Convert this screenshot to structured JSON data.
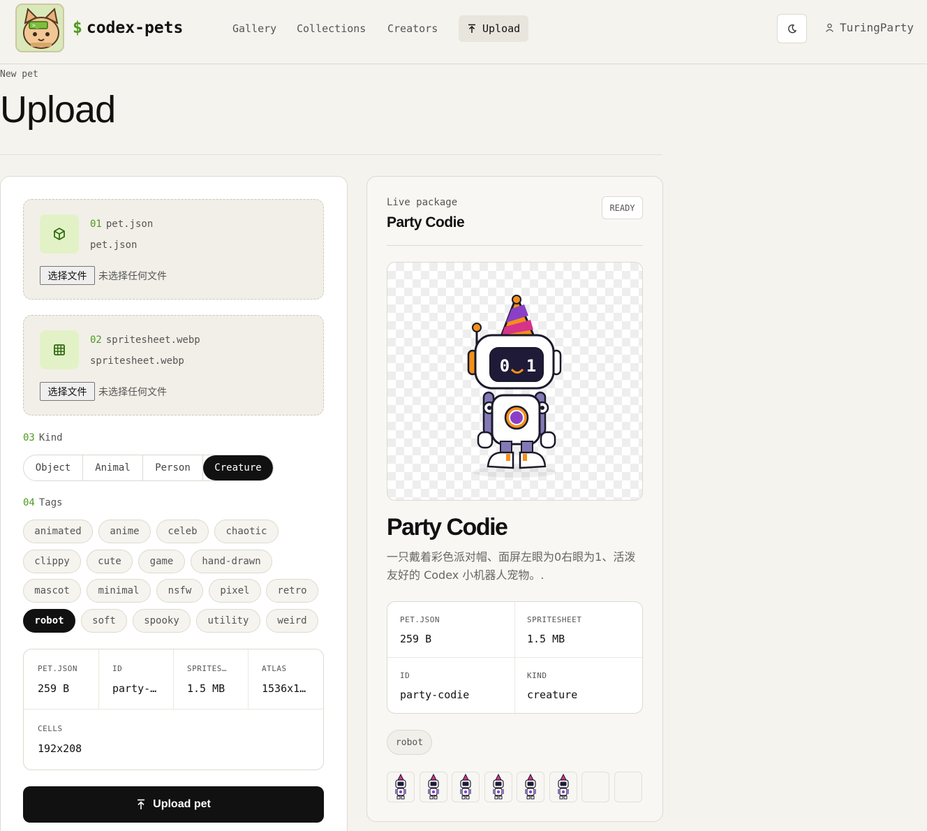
{
  "header": {
    "brand_symbol": "$",
    "brand": "codex-pets",
    "nav": [
      "Gallery",
      "Collections",
      "Creators",
      "Upload"
    ],
    "active_nav": "Upload",
    "user": "TuringParty"
  },
  "page": {
    "eyebrow": "New pet",
    "title": "Upload"
  },
  "form": {
    "files": [
      {
        "step": "01",
        "label": "pet.json",
        "filename": "pet.json",
        "button": "选择文件",
        "status": "未选择任何文件"
      },
      {
        "step": "02",
        "label": "spritesheet.webp",
        "filename": "spritesheet.webp",
        "button": "选择文件",
        "status": "未选择任何文件"
      }
    ],
    "kind": {
      "step": "03",
      "label": "Kind",
      "options": [
        "Object",
        "Animal",
        "Person",
        "Creature"
      ],
      "selected": "Creature"
    },
    "tags": {
      "step": "04",
      "label": "Tags",
      "options": [
        "animated",
        "anime",
        "celeb",
        "chaotic",
        "clippy",
        "cute",
        "game",
        "hand-drawn",
        "mascot",
        "minimal",
        "nsfw",
        "pixel",
        "retro",
        "robot",
        "soft",
        "spooky",
        "utility",
        "weird"
      ],
      "selected": [
        "robot"
      ]
    },
    "stats": [
      {
        "key": "PET.JSON",
        "value": "259 B"
      },
      {
        "key": "ID",
        "value": "party-…"
      },
      {
        "key": "SPRITES…",
        "value": "1.5 MB"
      },
      {
        "key": "ATLAS",
        "value": "1536x1…"
      },
      {
        "key": "CELLS",
        "value": "192x208"
      }
    ],
    "submit": "Upload pet"
  },
  "preview": {
    "label": "Live package",
    "name": "Party Codie",
    "status": "READY",
    "title": "Party Codie",
    "description": "一只戴着彩色派对帽、面屏左眼为0右眼为1、活泼友好的 Codex 小机器人宠物。.",
    "face_left": "0",
    "face_right": "1",
    "stats": [
      {
        "key": "PET.JSON",
        "value": "259 B"
      },
      {
        "key": "SPRITESHEET",
        "value": "1.5 MB"
      },
      {
        "key": "ID",
        "value": "party-codie"
      },
      {
        "key": "KIND",
        "value": "creature"
      }
    ],
    "tags": [
      "robot"
    ],
    "frames_filled": 6,
    "frames_total": 8
  },
  "colors": {
    "accent": "#4d9a1d",
    "background": "#f5f3ee",
    "selected": "#111111"
  }
}
